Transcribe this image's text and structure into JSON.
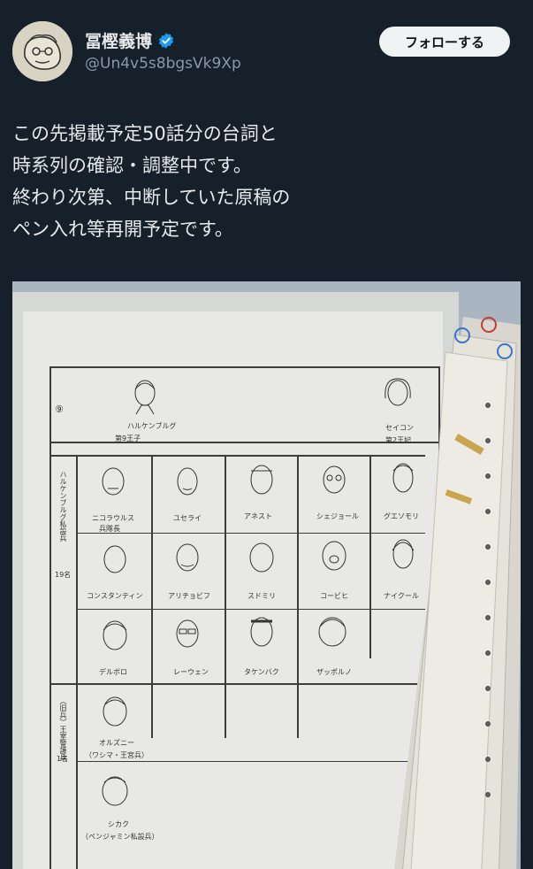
{
  "author": {
    "name": "冨樫義博",
    "handle": "@Un4v5s8bgsVk9Xp",
    "verified": true,
    "verified_color": "#1d9bf0"
  },
  "follow_button": {
    "label": "フォローする"
  },
  "tweet": {
    "lines": [
      "この先掲載予定50話分の台詞と",
      "時系列の確認・調整中です。",
      "終わり次第、中断していた原稿の",
      "ペン入れ等再開予定です。"
    ]
  },
  "sheet": {
    "number": "⑨",
    "top_left_caption_1": "ハルケンブルグ",
    "top_left_caption_2": "第9王子",
    "top_right_caption_1": "セイコン",
    "top_right_caption_2": "第2王妃",
    "side_label_1": "ハルケンブルグ私設兵",
    "side_count_1": "19名",
    "side_label_2": "（旧兵）王室警護兵",
    "side_count_2": "1名",
    "rows": [
      [
        "ニコラウルス",
        "ユセライ",
        "アネスト",
        "シェジョール",
        "グエソモリ"
      ],
      [
        "コンスタンティン",
        "アリチョビフ",
        "スドミリ",
        "コービヒ",
        "ナイクール"
      ],
      [
        "デルボロ",
        "レーウェン",
        "タケンバク",
        "ザッポルノ"
      ],
      [
        "オルズニー"
      ],
      [
        "シカク"
      ]
    ],
    "sub_captions": {
      "r1c1": "兵隊長",
      "r4": "（ワシマ・王宮兵）",
      "r5": "（ペンジャミン私設兵）"
    }
  },
  "colors": {
    "background": "#15202b",
    "text": "#e7e9ea",
    "secondary": "#8b98a5",
    "button_bg": "#eff3f4"
  }
}
